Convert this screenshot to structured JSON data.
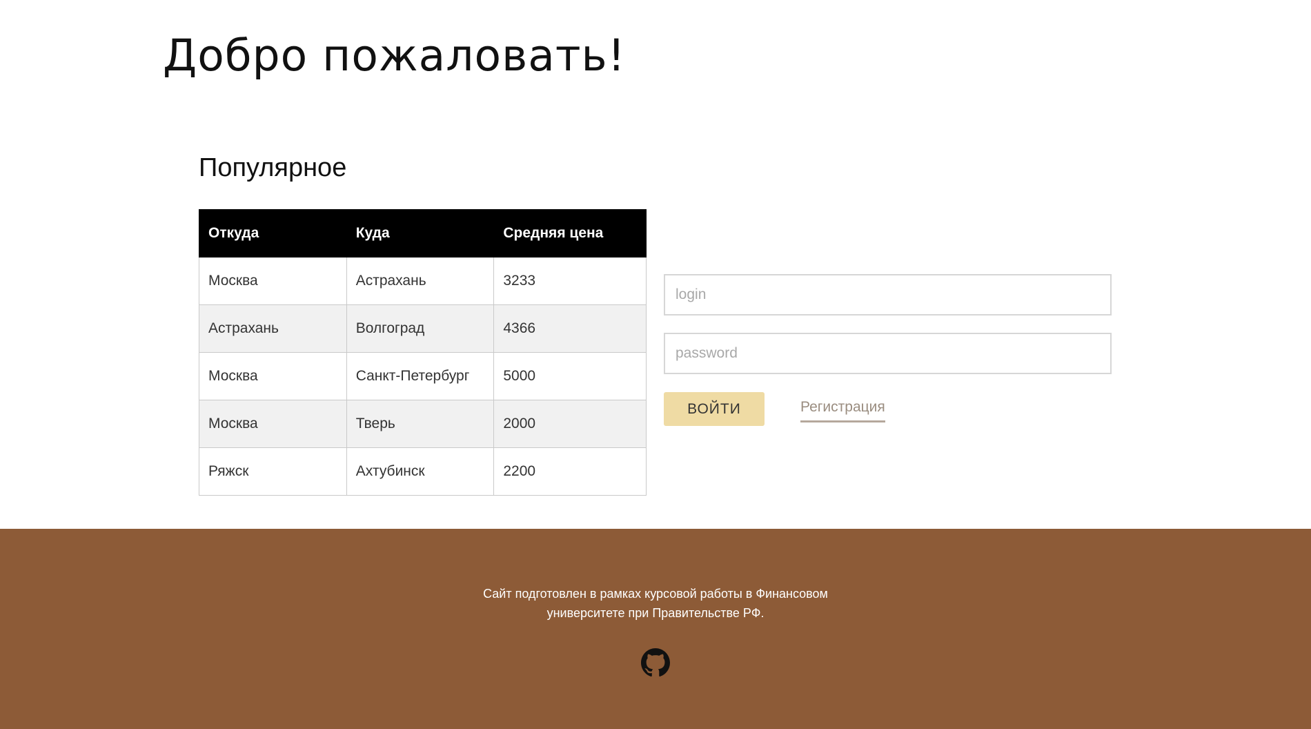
{
  "header": {
    "title": "Добро пожаловать!"
  },
  "popular": {
    "title": "Популярное",
    "columns": [
      "Откуда",
      "Куда",
      "Средняя цена"
    ],
    "rows": [
      [
        "Москва",
        "Астрахань",
        "3233"
      ],
      [
        "Астрахань",
        "Волгоград",
        "4366"
      ],
      [
        "Москва",
        "Санкт-Петербург",
        "5000"
      ],
      [
        "Москва",
        "Тверь",
        "2000"
      ],
      [
        "Ряжск",
        "Ахтубинск",
        "2200"
      ]
    ]
  },
  "login": {
    "login_placeholder": "login",
    "password_placeholder": "password",
    "submit_label": "ВОЙТИ",
    "register_label": "Регистрация"
  },
  "footer": {
    "line1": "Сайт подготовлен в рамках курсовой работы в Финансовом",
    "line2": "университете при Правительстве РФ.",
    "icon": "github-icon"
  },
  "colors": {
    "footer_bg": "#8d5b37",
    "button_bg": "#efdba4",
    "table_header_bg": "#000000"
  }
}
